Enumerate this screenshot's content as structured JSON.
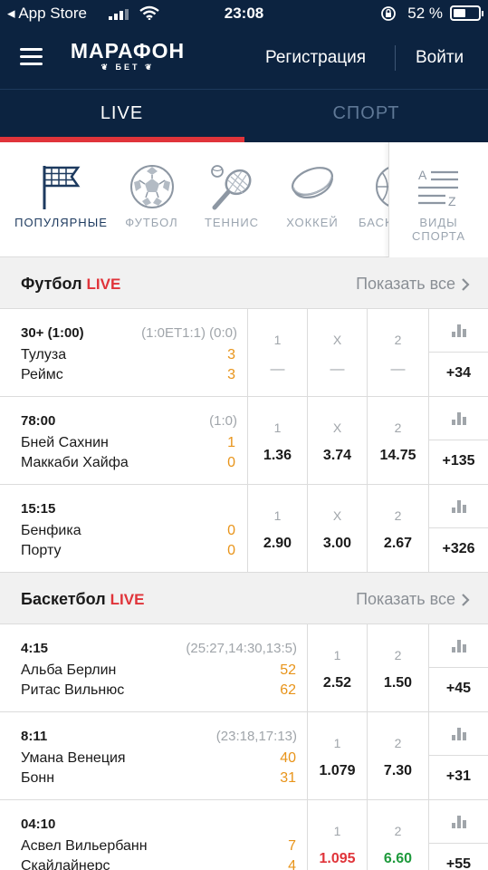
{
  "status_bar": {
    "carrier": "App Store",
    "time": "23:08",
    "battery": "52 %"
  },
  "header": {
    "logo_main": "МАРАФОН",
    "logo_sub": "БЕТ",
    "register": "Регистрация",
    "login": "Войти"
  },
  "tabs": {
    "live": "LIVE",
    "sport": "СПОРТ"
  },
  "categories": [
    {
      "label": "ПОПУЛЯРНЫЕ",
      "icon": "flag-icon"
    },
    {
      "label": "ФУТБОЛ",
      "icon": "soccer-ball-icon"
    },
    {
      "label": "ТЕННИС",
      "icon": "tennis-racket-icon"
    },
    {
      "label": "ХОККЕЙ",
      "icon": "hockey-puck-icon"
    },
    {
      "label": "БАСК",
      "icon": "basketball-icon"
    }
  ],
  "all_sports": {
    "line1": "ВИДЫ",
    "line2": "СПОРТА",
    "icon": "list-icon"
  },
  "football": {
    "title": "Футбол",
    "live": "LIVE",
    "show_all": "Показать все",
    "events": [
      {
        "time": "30+ (1:00)",
        "extra": "(1:0ET1:1) (0:0)",
        "team1": "Тулуза",
        "team2": "Реймс",
        "score1": "3",
        "score2": "3",
        "h1": "1",
        "hx": "X",
        "h2": "2",
        "o1": "—",
        "ox": "—",
        "o2": "—",
        "more": "+34"
      },
      {
        "time": "78:00",
        "extra": "(1:0)",
        "team1": "Бней Сахнин",
        "team2": "Маккаби Хайфа",
        "score1": "1",
        "score2": "0",
        "h1": "1",
        "hx": "X",
        "h2": "2",
        "o1": "1.36",
        "ox": "3.74",
        "o2": "14.75",
        "more": "+135"
      },
      {
        "time": "15:15",
        "extra": "",
        "team1": "Бенфика",
        "team2": "Порту",
        "score1": "0",
        "score2": "0",
        "h1": "1",
        "hx": "X",
        "h2": "2",
        "o1": "2.90",
        "ox": "3.00",
        "o2": "2.67",
        "more": "+326"
      }
    ]
  },
  "basketball": {
    "title": "Баскетбол",
    "live": "LIVE",
    "show_all": "Показать все",
    "events": [
      {
        "time": "4:15",
        "extra": "(25:27,14:30,13:5)",
        "team1": "Альба Берлин",
        "team2": "Ритас Вильнюс",
        "score1": "52",
        "score2": "62",
        "h1": "1",
        "h2": "2",
        "o1": "2.52",
        "o2": "1.50",
        "more": "+45"
      },
      {
        "time": "8:11",
        "extra": "(23:18,17:13)",
        "team1": "Умана Венеция",
        "team2": "Бонн",
        "score1": "40",
        "score2": "31",
        "h1": "1",
        "h2": "2",
        "o1": "1.079",
        "o2": "7.30",
        "more": "+31"
      },
      {
        "time": "04:10",
        "extra": "",
        "team1": "Асвел Вильербанн",
        "team2": "Скайлайнерс",
        "score1": "7",
        "score2": "4",
        "h1": "1",
        "h2": "2",
        "o1": "1.095",
        "o2": "6.60",
        "more": "+55"
      }
    ]
  },
  "colors": {
    "header_bg": "#0c2340",
    "accent_red": "#e0343a",
    "score_orange": "#e8941a",
    "odd_up": "#1e9a3c"
  }
}
